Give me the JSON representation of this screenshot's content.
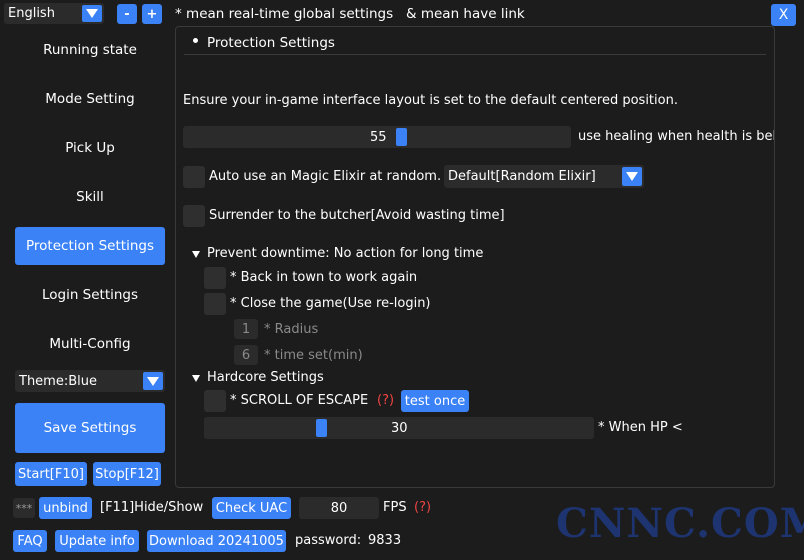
{
  "top": {
    "language": "English",
    "minus_label": "-",
    "plus_label": "+",
    "notice": "* mean real-time global settings   & mean have link",
    "close_label": "X"
  },
  "sidebar": {
    "items": [
      {
        "label": "Running state"
      },
      {
        "label": "Mode Setting"
      },
      {
        "label": "Pick Up"
      },
      {
        "label": "Skill"
      },
      {
        "label": "Protection Settings",
        "active": true
      },
      {
        "label": "Login Settings"
      },
      {
        "label": "Multi-Config"
      }
    ],
    "theme": "Theme:Blue",
    "save_label": "Save Settings",
    "start_label": "Start[F10]",
    "stop_label": "Stop[F12]"
  },
  "panel": {
    "title": "Protection Settings",
    "instruction": "Ensure your in-game interface layout is set to the default centered position.",
    "heal_slider": {
      "value": 55,
      "fill_fraction": 0.55,
      "label": "use healing when health is belo"
    },
    "elixir": {
      "label": "Auto use an Magic Elixir at random.",
      "select_value": "Default[Random Elixir]"
    },
    "surrender_label": "Surrender to the butcher[Avoid wasting time]",
    "downtime": {
      "title": "Prevent downtime: No action for long time",
      "back_town_label": "* Back in town to work again",
      "close_game_label": "* Close the game(Use re-login)",
      "radius_value": "1",
      "radius_label": "* Radius",
      "time_value": "6",
      "time_label": "* time set(min)"
    },
    "hardcore": {
      "title": "Hardcore Settings",
      "scroll_label": "* SCROLL OF ESCAPE",
      "help_mark": "(?)",
      "test_label": "test once",
      "hp_slider": {
        "value": 30,
        "fill_fraction": 0.3,
        "label": "* When HP <"
      }
    }
  },
  "bottom": {
    "masked": "***",
    "unbind_label": "unbind",
    "hide_show": "[F11]Hide/Show",
    "check_uac_label": "Check UAC",
    "fps_value": "80",
    "fps_label": "FPS",
    "fps_help": "(?)",
    "faq_label": "FAQ",
    "update_label": "Update info",
    "download_label": "Download 20241005",
    "password_label": "password:",
    "password_value": "9833"
  },
  "watermark": "CNNC.COM",
  "colors": {
    "accent": "#3b82f6",
    "background": "#1c1c1c",
    "help": "#ef4444"
  }
}
